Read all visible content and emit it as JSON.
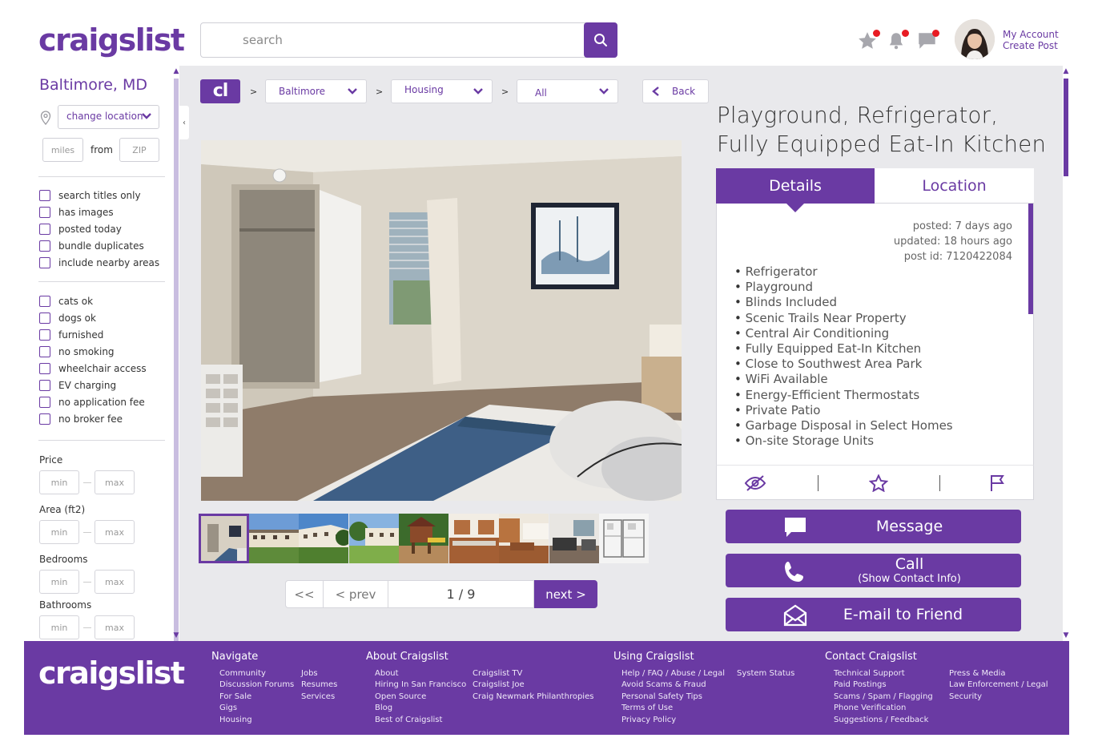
{
  "header": {
    "logo": "craigslist",
    "search_placeholder": "search",
    "account": {
      "my_account": "My Account",
      "create_post": "Create Post"
    },
    "icons": [
      "star-icon",
      "bell-icon",
      "chat-icon"
    ]
  },
  "sidebar": {
    "city": "Baltimore, MD",
    "change_location": "change location",
    "miles_placeholder": "miles",
    "from_label": "from",
    "zip_placeholder": "ZIP",
    "filters_a": [
      "search titles only",
      "has images",
      "posted today",
      "bundle duplicates",
      "include nearby areas"
    ],
    "filters_b": [
      "cats ok",
      "dogs ok",
      "furnished",
      "no smoking",
      "wheelchair access",
      "EV charging",
      "no application fee",
      "no broker fee"
    ],
    "ranges": [
      {
        "label": "Price",
        "min": "min",
        "max": "max"
      },
      {
        "label": "Area (ft2)",
        "min": "min",
        "max": "max"
      },
      {
        "label": "Bedrooms",
        "min": "min",
        "max": "max"
      },
      {
        "label": "Bathrooms",
        "min": "min",
        "max": "max"
      }
    ]
  },
  "breadcrumb": {
    "logo": "cl",
    "separator": ">",
    "items": [
      "Baltimore",
      "Housing",
      "All"
    ],
    "back": "Back"
  },
  "gallery": {
    "current": "1 / 9",
    "first": "<<",
    "prev": "< prev",
    "next": "next >"
  },
  "listing": {
    "title": "Playground, Refrigerator, Fully Equipped Eat-In Kitchen",
    "tabs": {
      "details": "Details",
      "location": "Location"
    },
    "posted": "posted: 7 days ago",
    "updated": "updated: 18 hours ago",
    "post_id": "post id: 7120422084",
    "features": [
      "Refrigerator",
      "Playground",
      "Blinds Included",
      "Scenic Trails Near Property",
      "Central Air Conditioning",
      "Fully Equipped Eat-In Kitchen",
      "Close to Southwest Area Park",
      "WiFi Available",
      "Energy-Efficient Thermostats",
      "Private Patio",
      "Garbage Disposal in Select Homes",
      "On-site Storage Units"
    ]
  },
  "actions": {
    "message": "Message",
    "call": "Call",
    "call_sub": "(Show Contact Info)",
    "email": "E-mail to Friend"
  },
  "footer": {
    "logo": "craigslist",
    "navigate": {
      "title": "Navigate",
      "col1": [
        "Community",
        "Discussion Forums",
        "For Sale",
        "Gigs",
        "Housing"
      ],
      "col2": [
        "Jobs",
        "Resumes",
        "Services"
      ]
    },
    "about": {
      "title": "About Craigslist",
      "col1": [
        "About",
        "Hiring In San Francisco",
        "Open Source",
        "Blog",
        "Best of Craigslist"
      ],
      "col2": [
        "Craigslist TV",
        "Craigslist Joe",
        "Craig Newmark Philanthropies"
      ]
    },
    "using": {
      "title": "Using Craigslist",
      "col1": [
        "Help / FAQ / Abuse / Legal",
        "Avoid Scams & Fraud",
        "Personal Safety Tips",
        "Terms of Use",
        "Privacy Policy"
      ],
      "col2": [
        "System Status"
      ]
    },
    "contact": {
      "title": "Contact Craigslist",
      "col1": [
        "Technical Support",
        "Paid Postings",
        "Scams / Spam / Flagging",
        "Phone Verification",
        "Suggestions / Feedback"
      ],
      "col2": [
        "Press & Media",
        "Law Enforcement / Legal",
        "Security"
      ]
    }
  },
  "colors": {
    "accent": "#6a3aa3",
    "background": "#e9e9ec",
    "notification": "#e81b23"
  }
}
